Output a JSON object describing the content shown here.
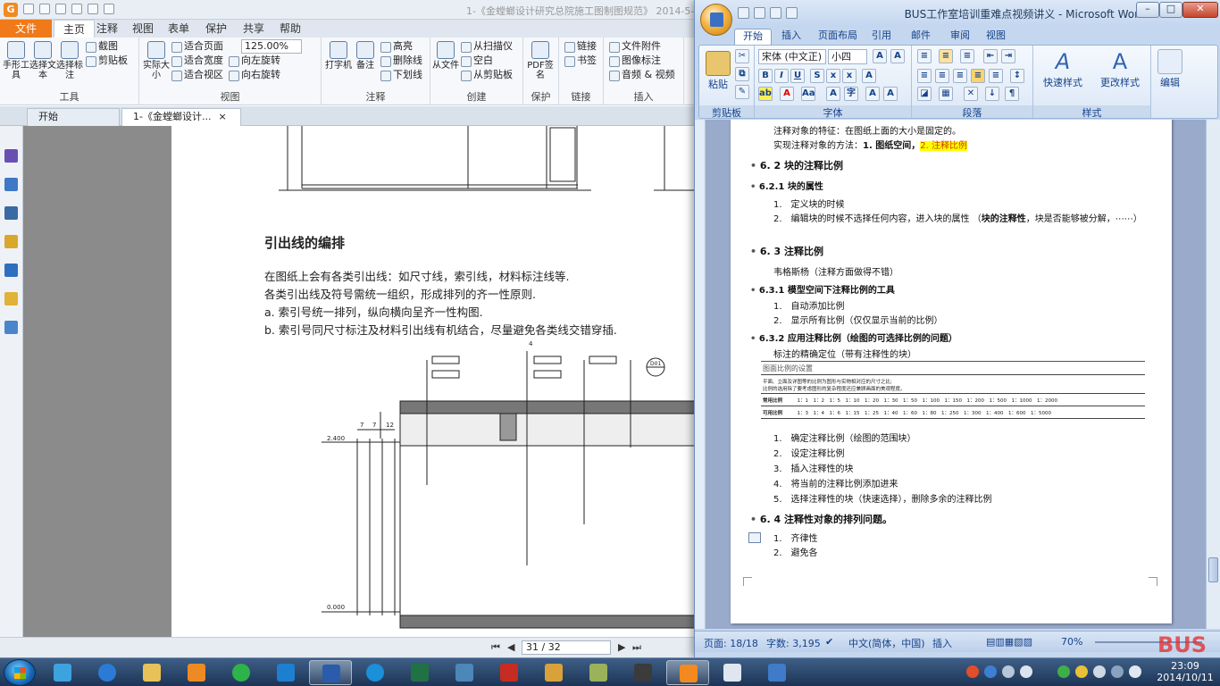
{
  "pdf": {
    "window_title": "1-《金螳螂设计研究总院施工图制图规范》 2014-5-",
    "menu_tabs": [
      "文件",
      "主页",
      "注释",
      "视图",
      "表单",
      "保护",
      "共享",
      "帮助"
    ],
    "active_tab": "主页",
    "ribbon": {
      "tools": {
        "label": "工具",
        "hand": "手形工具",
        "select_text": "选择文本",
        "select_annot": "选择标注",
        "screenshot": "截图",
        "clipboard": "剪贴板"
      },
      "view": {
        "label": "视图",
        "actual_size": "实际大小",
        "fit_page": "适合页面",
        "fit_width": "适合宽度",
        "fit_view": "适合视区",
        "zoom": "125.00%",
        "rotate_left": "向左旋转",
        "rotate_right": "向右旋转"
      },
      "comment": {
        "label": "注释",
        "typewriter": "打字机",
        "note": "备注",
        "highlight": "高亮",
        "strikeout": "删除线",
        "underline": "下划线"
      },
      "create": {
        "label": "创建",
        "from_file": "从文件",
        "from_scanner": "从扫描仪",
        "blank": "空白",
        "from_clipboard": "从剪贴板"
      },
      "protect": {
        "label": "保护",
        "pdf_sign": "PDF签名"
      },
      "links": {
        "label": "链接",
        "link": "链接",
        "bookmark": "书签"
      },
      "insert": {
        "label": "插入",
        "file_attach": "文件附件",
        "image_annot": "图像标注",
        "audio_video": "音频 & 视频"
      }
    },
    "doc_tabs": [
      "开始",
      "1-《金螳螂设计..."
    ],
    "page": {
      "heading": "引出线的编排",
      "lines": [
        "在图纸上会有各类引出线：如尺寸线，索引线，材料标注线等.",
        "各类引出线及符号需统一组织，形成排列的齐一性原则.",
        "a. 索引号统一排列，纵向横向呈齐一性构图.",
        "b. 索引号同尺寸标注及材料引出线有机结合，尽量避免各类线交错穿插."
      ],
      "dim_labels": [
        "2.400",
        "0.000",
        "7",
        "7",
        "12",
        "4"
      ],
      "callout": "D01"
    },
    "status": {
      "page_box": "31 / 32"
    }
  },
  "word": {
    "title": "BUS工作室培训重难点视频讲义 - Microsoft Word",
    "tabs": [
      "开始",
      "插入",
      "页面布局",
      "引用",
      "邮件",
      "审阅",
      "视图"
    ],
    "active_tab": "开始",
    "font_name": "宋体 (中文正)",
    "font_size": "小四",
    "groups": {
      "clipboard": "剪贴板",
      "font": "字体",
      "paragraph": "段落",
      "styles": "样式"
    },
    "buttons": {
      "paste": "粘贴",
      "quick_styles": "快速样式",
      "change_styles": "更改样式",
      "edit": "编辑"
    },
    "doc": {
      "l1": "注释对象的特征：在图纸上面的大小是固定的。",
      "l2a": "实现注释对象的方法：",
      "l2b": "1. 图纸空间，",
      "l2c": "2. 注释比例",
      "h62": "6. 2 块的注释比例",
      "h621": "6.2.1 块的属性",
      "i621_1": "定义块的时候",
      "i621_2a": "编辑块的时候不选择任何内容，进入块的属性 （",
      "i621_2b": "块的注释性",
      "i621_2c": "，块是否能够被分解，⋯⋯）",
      "h63": "6. 3 注释比例",
      "p63": "韦格斯杨（注释方面做得不错）",
      "h631": "6.3.1 模型空间下注释比例的工具",
      "i631_1": "自动添加比例",
      "i631_2": "显示所有比例（仅仅显示当前的比例）",
      "h632": "6.3.2 应用注释比例（绘图的可选择比例的问题）",
      "p632": "标注的精确定位（带有注释性的块）",
      "table": {
        "title": "图面比例的设置",
        "desc1": "平面、立面及详图等的比例为图形与实物相对应的尺寸之比;",
        "desc2": "比例的选用除了要考虑图形的复杂程度还应兼顾画面的美观程度。",
        "row1_label": "常用比例",
        "row1_vals": "1：1　1：2　1：5　1：10　1：20　1：30　1：50　1：100　1：150　1：200　1：500　1：1000　1：2000",
        "row2_label": "可用比例",
        "row2_vals": "1：3　1：4　1：6　1：15　1：25　1：40　1：60　1：80　1：250　1：300　1：400　1：600　1：5000"
      },
      "steps": [
        "确定注释比例（绘图的范围块）",
        "设定注释比例",
        "插入注释性的块",
        "将当前的注释比例添加进来",
        "选择注释性的块（快速选择），删除多余的注释比例"
      ],
      "h64": "6. 4 注释性对象的排列问题。",
      "i64": [
        "齐律性",
        "避免各"
      ]
    },
    "status": {
      "page": "页面: 18/18",
      "words": "字数: 3,195",
      "lang": "中文(简体，中国)",
      "insert": "插入",
      "zoom": "70%"
    }
  },
  "taskbar": {
    "time": "23:09",
    "date": "2014/10/11"
  },
  "watermark": "BUS"
}
